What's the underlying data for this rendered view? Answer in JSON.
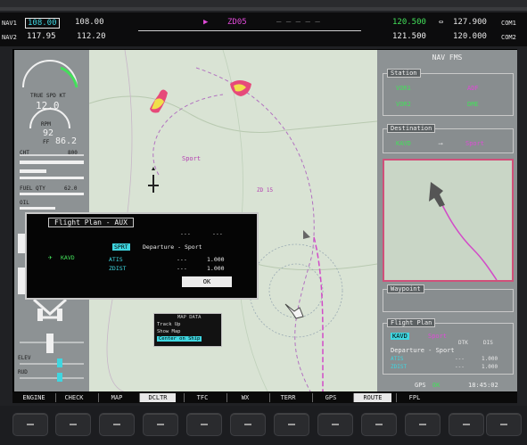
{
  "topbar": {
    "nav1_label": "NAV1",
    "nav1_active": "108.00",
    "nav1_standby": "108.00",
    "nav2_label": "NAV2",
    "nav2_active": "117.95",
    "nav2_standby": "112.20",
    "dtk_waypoint": "ZD05",
    "com1_active": "120.500",
    "com1_standby": "127.900",
    "com1_label": "COM1",
    "com2_active": "121.500",
    "com2_standby": "120.000",
    "com2_label": "COM2"
  },
  "leftpanel": {
    "airspeed_label": "TRUE SPD KT",
    "airspeed": "12.0",
    "rpm_label": "RPM",
    "rpm_value": "92",
    "ff_label": "FF",
    "ff_value": "86.2",
    "cht_label": "CHT",
    "cht_value": "800",
    "fuel_qty_label": "FUEL QTY",
    "fuel_qty_value": "62.0",
    "oil_label": "OIL",
    "elev_label": "ELEV",
    "rud_label": "RUD"
  },
  "dialog": {
    "title": "Flight Plan - AUX",
    "col1": "---",
    "col2": "---",
    "highlight": "SPRT",
    "row1": "Departure - Sport",
    "origin": "KAVD",
    "row2a_left": "ATIS",
    "row2a_mid": "---",
    "row2a_right": "1.000",
    "row2b_left": "ZDIST",
    "row2b_mid": "---",
    "row2b_right": "1.000",
    "ok_label": "OK"
  },
  "map": {
    "waypoint_label": "Sport",
    "airway_label": "ZD 15"
  },
  "minibox": {
    "title": "MAP DATA",
    "line1": "Track Up",
    "line2": "Show Map",
    "line3": "Center on Ship"
  },
  "rightpanel": {
    "title": "NAV FMS",
    "nav_section": "Station",
    "nav_left1": "VOR1",
    "nav_left2": "VOR2",
    "nav_right1": "ADF",
    "nav_right2": "DME",
    "dest_section": "Destination",
    "dest_from": "KAVD",
    "dest_to": "Sport",
    "inset_section": "Waypoint",
    "fp_section": "Flight Plan",
    "fp_highlight": "KAVD",
    "fp_to": "Sport",
    "fp_col1": "DTK",
    "fp_col2": "DIS",
    "fp_row1": "Departure - Sport",
    "fp_row2_left": "ATIS",
    "fp_row2_mid": "---",
    "fp_row2_right": "1.000",
    "fp_row3_left": "ZDIST",
    "fp_row3_mid": "---",
    "fp_row3_right": "1.000",
    "status_label": "GPS",
    "status_value": "OK",
    "clock": "18:45:02"
  },
  "softkeys": [
    {
      "label": "ENGINE",
      "active": false
    },
    {
      "label": "CHECK",
      "active": false
    },
    {
      "label": "MAP",
      "active": false
    },
    {
      "label": "DCLTR",
      "active": true
    },
    {
      "label": "TFC",
      "active": false
    },
    {
      "label": "WX",
      "active": false
    },
    {
      "label": "TERR",
      "active": false
    },
    {
      "label": "GPS",
      "active": false
    },
    {
      "label": "ROUTE",
      "active": true
    },
    {
      "label": "FPL",
      "active": false
    }
  ],
  "colors": {
    "map_bg": "#d9e3d4",
    "magenta": "#e04ad8",
    "green": "#43e05a",
    "cyan": "#3fd6e0"
  }
}
